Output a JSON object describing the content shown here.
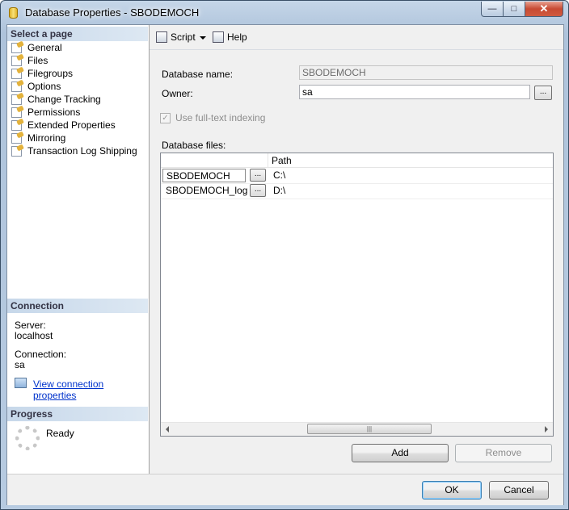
{
  "window": {
    "title": "Database Properties - SBODEMOCH"
  },
  "left": {
    "select_page_heading": "Select a page",
    "pages": [
      {
        "label": "General"
      },
      {
        "label": "Files"
      },
      {
        "label": "Filegroups"
      },
      {
        "label": "Options"
      },
      {
        "label": "Change Tracking"
      },
      {
        "label": "Permissions"
      },
      {
        "label": "Extended Properties"
      },
      {
        "label": "Mirroring"
      },
      {
        "label": "Transaction Log Shipping"
      }
    ],
    "connection_heading": "Connection",
    "server_label": "Server:",
    "server_value": "localhost",
    "connection_label": "Connection:",
    "connection_value": "sa",
    "view_link": "View connection properties",
    "progress_heading": "Progress",
    "progress_status": "Ready"
  },
  "toolbar": {
    "script_label": "Script",
    "help_label": "Help"
  },
  "form": {
    "db_name_label": "Database name:",
    "db_name_value": "SBODEMOCH",
    "owner_label": "Owner:",
    "owner_value": "sa",
    "fulltext_label": "Use full-text indexing",
    "fulltext_checked": true,
    "files_label": "Database files:",
    "path_header": "Path",
    "browse_label": "...",
    "files": [
      {
        "name": "SBODEMOCH",
        "path": "C:\\"
      },
      {
        "name": "SBODEMOCH_log",
        "path": "D:\\"
      }
    ],
    "add_label": "Add",
    "remove_label": "Remove"
  },
  "footer": {
    "ok_label": "OK",
    "cancel_label": "Cancel"
  }
}
